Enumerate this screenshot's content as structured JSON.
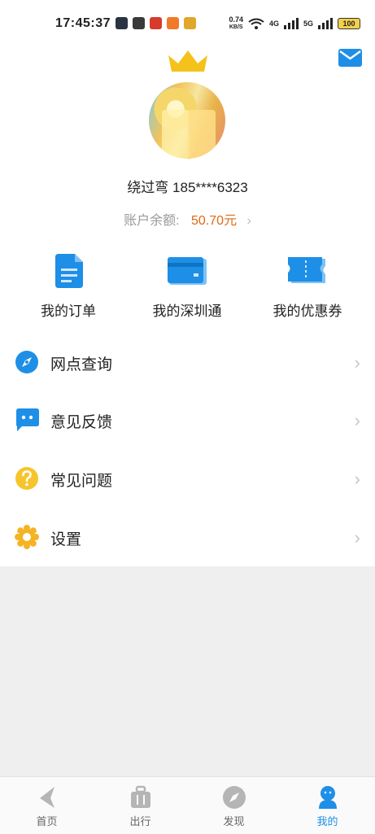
{
  "status_bar": {
    "time": "17:45:37",
    "net_speed_value": "0.74",
    "net_speed_unit": "KB/S",
    "network_a": "4G",
    "network_b": "5G",
    "battery": "100"
  },
  "profile": {
    "username": "绕过弯 185****6323",
    "balance_label": "账户余额:",
    "balance_value": "50.70元"
  },
  "shortcuts": [
    {
      "label": "我的订单",
      "icon": "order-document-icon"
    },
    {
      "label": "我的深圳通",
      "icon": "shenzhen-card-icon"
    },
    {
      "label": "我的优惠券",
      "icon": "coupon-ticket-icon"
    }
  ],
  "menu": [
    {
      "label": "网点查询",
      "icon": "compass-icon"
    },
    {
      "label": "意见反馈",
      "icon": "chat-bubble-icon"
    },
    {
      "label": "常见问题",
      "icon": "question-icon"
    },
    {
      "label": "设置",
      "icon": "gear-icon"
    }
  ],
  "tabs": [
    {
      "label": "首页",
      "icon": "home-plane-icon"
    },
    {
      "label": "出行",
      "icon": "luggage-icon"
    },
    {
      "label": "发现",
      "icon": "compass-icon"
    },
    {
      "label": "我的",
      "icon": "person-icon"
    }
  ],
  "colors": {
    "accent": "#1e8fe6",
    "balance": "#e06a14",
    "crown": "#f4c21b",
    "question": "#f6c52b",
    "gear": "#f5b324"
  }
}
